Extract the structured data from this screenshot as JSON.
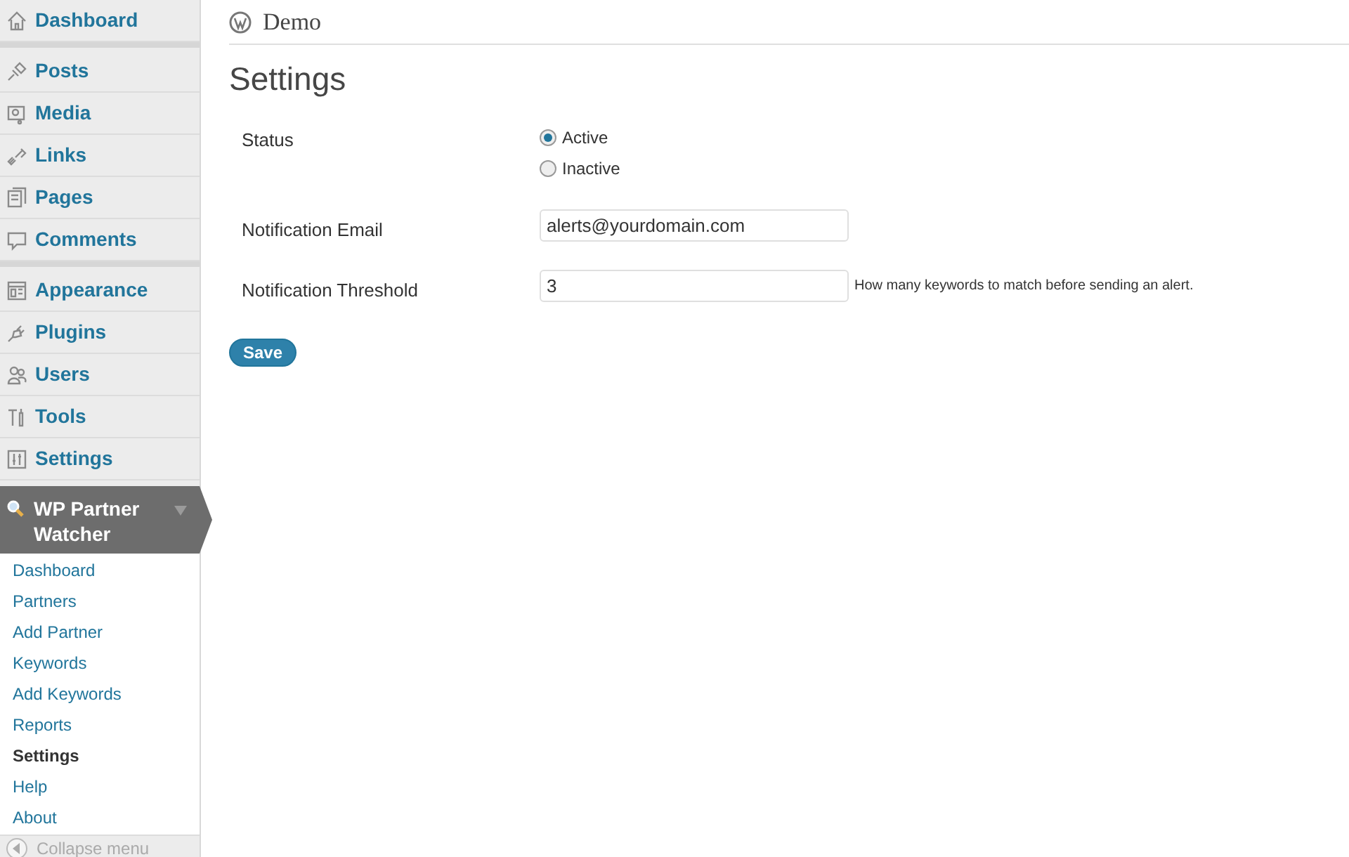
{
  "sidebar": {
    "groups": [
      [
        {
          "kind": "dashboard",
          "label": "Dashboard"
        }
      ],
      [
        {
          "kind": "posts",
          "label": "Posts"
        },
        {
          "kind": "media",
          "label": "Media"
        },
        {
          "kind": "links",
          "label": "Links"
        },
        {
          "kind": "pages",
          "label": "Pages"
        },
        {
          "kind": "comments",
          "label": "Comments"
        }
      ],
      [
        {
          "kind": "appearance",
          "label": "Appearance"
        },
        {
          "kind": "plugins",
          "label": "Plugins"
        },
        {
          "kind": "users",
          "label": "Users"
        },
        {
          "kind": "tools",
          "label": "Tools"
        },
        {
          "kind": "settings",
          "label": "Settings"
        }
      ]
    ],
    "active_menu": {
      "label": "WP Partner Watcher",
      "expanded": true,
      "children": [
        {
          "label": "Dashboard",
          "selected": false
        },
        {
          "label": "Partners",
          "selected": false
        },
        {
          "label": "Add Partner",
          "selected": false
        },
        {
          "label": "Keywords",
          "selected": false
        },
        {
          "label": "Add Keywords",
          "selected": false
        },
        {
          "label": "Reports",
          "selected": false
        },
        {
          "label": "Settings",
          "selected": true
        },
        {
          "label": "Help",
          "selected": false
        },
        {
          "label": "About",
          "selected": false
        }
      ]
    },
    "collapse": "Collapse menu"
  },
  "header": {
    "site": "Demo"
  },
  "page_title": "Settings",
  "form": {
    "status": {
      "label": "Status",
      "options": [
        {
          "label": "Active",
          "selected": true
        },
        {
          "label": "Inactive",
          "selected": false
        }
      ]
    },
    "email": {
      "label": "Notification Email",
      "value": "alerts@yourdomain.com"
    },
    "threshold": {
      "label": "Notification Threshold",
      "value": "3",
      "hint": "How many keywords to match before sending an alert."
    },
    "save": "Save"
  }
}
